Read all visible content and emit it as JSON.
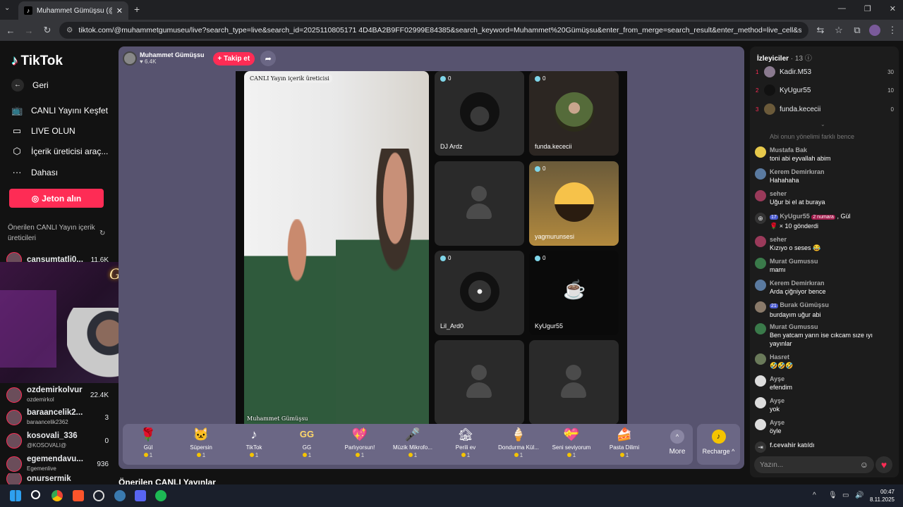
{
  "browser": {
    "tab_title": "Muhammet Gümüşsu (@m",
    "url": "tiktok.com/@muhammetgumuseu/live?search_type=live&search_id=2025110805171 4D4BA2B9FF02999E84385&search_keyword=Muhammet%20Gümüşsu&enter_from_merge=search_result&enter_method=live_cell&search_result_id=757009110940...",
    "new_tab": "+"
  },
  "sidebar": {
    "logo": "TikTok",
    "back": "Geri",
    "items": [
      {
        "label": "CANLI Yayını Keşfet",
        "icon": "live-tv-icon"
      },
      {
        "label": "LIVE OLUN",
        "icon": "video-camera-icon"
      },
      {
        "label": "İçerik üreticisi araç...",
        "icon": "creator-tools-icon"
      },
      {
        "label": "Dahası",
        "icon": "more-dots-icon"
      }
    ],
    "jeton_button": "Jeton alın",
    "suggested_title": "Önerilen CANLI Yayın içerik üreticileri",
    "suggested": [
      {
        "name": "cansumtatli0...",
        "handle": "",
        "count": "11.6K"
      },
      {
        "name": "ozdemirkolvur",
        "handle": "ozdemirkol",
        "count": "22.4K"
      },
      {
        "name": "baraancelik2...",
        "handle": "baraancelik2362",
        "count": "3"
      },
      {
        "name": "kosovali_336",
        "handle": "@KOSOVALI@",
        "count": "0"
      },
      {
        "name": "egemendavu...",
        "handle": "Egemenlive",
        "count": "936"
      },
      {
        "name": "onursermik",
        "handle": "",
        "count": ""
      }
    ],
    "pip_neon": "Gebelo"
  },
  "live": {
    "host_name": "Muhammet Gümüşsu",
    "host_likes": "♥ 6.4K",
    "follow_button": "+ Takip et",
    "video_label": "CANLI Yayın içerik üreticisi",
    "video_host": "Muhammet Gümüşsu",
    "seats": [
      {
        "name": "DJ Ardz",
        "count": "0"
      },
      {
        "name": "funda.kececii",
        "count": "0"
      },
      {
        "name": "",
        "count": ""
      },
      {
        "name": "yagmurunsesi",
        "count": "0"
      },
      {
        "name": "Lil_Ard0",
        "count": "0"
      },
      {
        "name": "KyUgur55",
        "count": "0"
      },
      {
        "name": "",
        "count": ""
      },
      {
        "name": "",
        "count": ""
      }
    ],
    "gifts": [
      {
        "name": "Gül",
        "price": "1",
        "icon": "🌹"
      },
      {
        "name": "Süpersin",
        "price": "1",
        "icon": "🐱"
      },
      {
        "name": "TikTok",
        "price": "1",
        "icon": "♪"
      },
      {
        "name": "GG",
        "price": "1",
        "icon": "GG"
      },
      {
        "name": "Parlıyorsun!",
        "price": "1",
        "icon": "💖"
      },
      {
        "name": "Müzik Mikrofo...",
        "price": "1",
        "icon": "🎤"
      },
      {
        "name": "Perili ev",
        "price": "1",
        "icon": "🏚"
      },
      {
        "name": "Dondurma Kül...",
        "price": "1",
        "icon": "🍦"
      },
      {
        "name": "Seni seviyorum",
        "price": "1",
        "icon": "💝"
      },
      {
        "name": "Pasta Dilimi",
        "price": "1",
        "icon": "🍰"
      }
    ],
    "more": "More",
    "recharge": "Recharge ^",
    "suggested_lives_title": "Önerilen CANLI Yayınlar"
  },
  "chat": {
    "viewers_title": "İzleyiciler",
    "viewers_count": "· 13",
    "top_viewers": [
      {
        "rank": "1",
        "name": "Kadir.M53",
        "score": "30"
      },
      {
        "rank": "2",
        "name": "KyUgur55",
        "score": "10"
      },
      {
        "rank": "3",
        "name": "funda.kececii",
        "score": "0"
      }
    ],
    "faded_msg": "Abi onun yönelimi farklı bence",
    "messages": [
      {
        "user": "Mustafa Bak",
        "text": "toni abi eyvallah abim"
      },
      {
        "user": "Kerem Demirkıran",
        "text": "Hahahaha"
      },
      {
        "user": "seher",
        "text": "Uğur bi el at buraya"
      },
      {
        "user": "KyUgur55",
        "text": "🌹 × 10 gönderdi",
        "badge": "2 numara",
        "level": "17",
        "suffix": ", Gül"
      },
      {
        "user": "seher",
        "text": "Kızıyo o seses 😂"
      },
      {
        "user": "Murat Gumussu",
        "text": "mamı"
      },
      {
        "user": "Kerem Demirkıran",
        "text": "Arda çiğniyor bence"
      },
      {
        "user": "Burak Gümüşsu",
        "text": "burdayım uğur abi",
        "level": "21"
      },
      {
        "user": "Murat Gumussu",
        "text": "Ben yatcam yarın ise cıkcam sıze ıyı yayınlar"
      },
      {
        "user": "Hasret",
        "text": "🤣🤣🤣"
      },
      {
        "user": "Ayşe",
        "text": "efendim"
      },
      {
        "user": "Ayşe",
        "text": "yok"
      },
      {
        "user": "Ayşe",
        "text": "öyle"
      }
    ],
    "joined_user": "f.cevahir",
    "joined_text": "katıldı",
    "input_placeholder": "Yazın..."
  },
  "taskbar": {
    "time": "00:47",
    "date": "8.11.2025"
  },
  "colors": {
    "accent": "#fe2c55",
    "stage_bg": "#57536f",
    "gift_bar": "#6b6785"
  }
}
